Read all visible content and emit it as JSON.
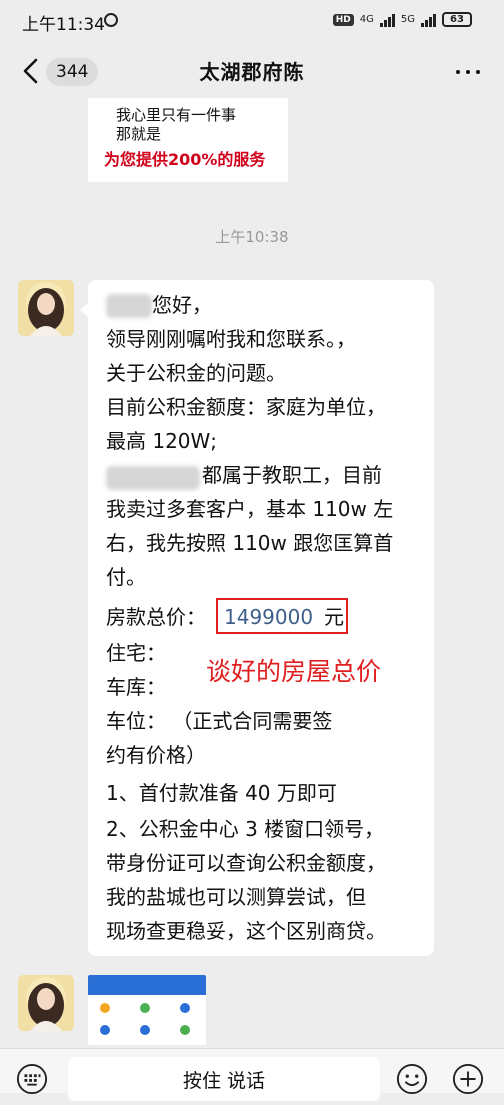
{
  "status_bar": {
    "time": "上午11:34",
    "hd": "HD",
    "net1": "4G",
    "net2": "5G",
    "battery": "63"
  },
  "header": {
    "unread_count": "344",
    "title": "太湖郡府陈"
  },
  "top_image": {
    "line1": "我心里只有一件事",
    "line2": "那就是",
    "line3": "为您提供200%的服务"
  },
  "time_separator": "上午10:38",
  "message": {
    "greeting": "您好，",
    "lines": [
      "领导刚刚嘱咐我和您联系。，",
      "关于公积金的问题。",
      "目前公积金额度：家庭为单位，",
      "最高 120W;",
      "都属于教职工，目前",
      "我卖过多套客户，基本 110w 左",
      "右，我先按照 110w 跟您匡算首",
      "付。"
    ],
    "price_label": "房款总价：",
    "price_value": "1499000",
    "price_unit": "元",
    "after_lines": [
      "住宅：",
      "车库：",
      "车位：        （正式合同需要签",
      "约有价格）",
      "1、首付款准备 40 万即可",
      "2、公积金中心 3 楼窗口领号，",
      "带身份证可以查询公积金额度，",
      "我的盐城也可以测算尝试，但",
      "现场查更稳妥，这个区别商贷。"
    ]
  },
  "annotation": "谈好的房屋总价",
  "input_bar": {
    "hold_to_talk": "按住 说话"
  },
  "colors": {
    "annotation_red": "#e02020",
    "price_blue": "#3e5f8a",
    "chat_bg": "#ededed"
  }
}
